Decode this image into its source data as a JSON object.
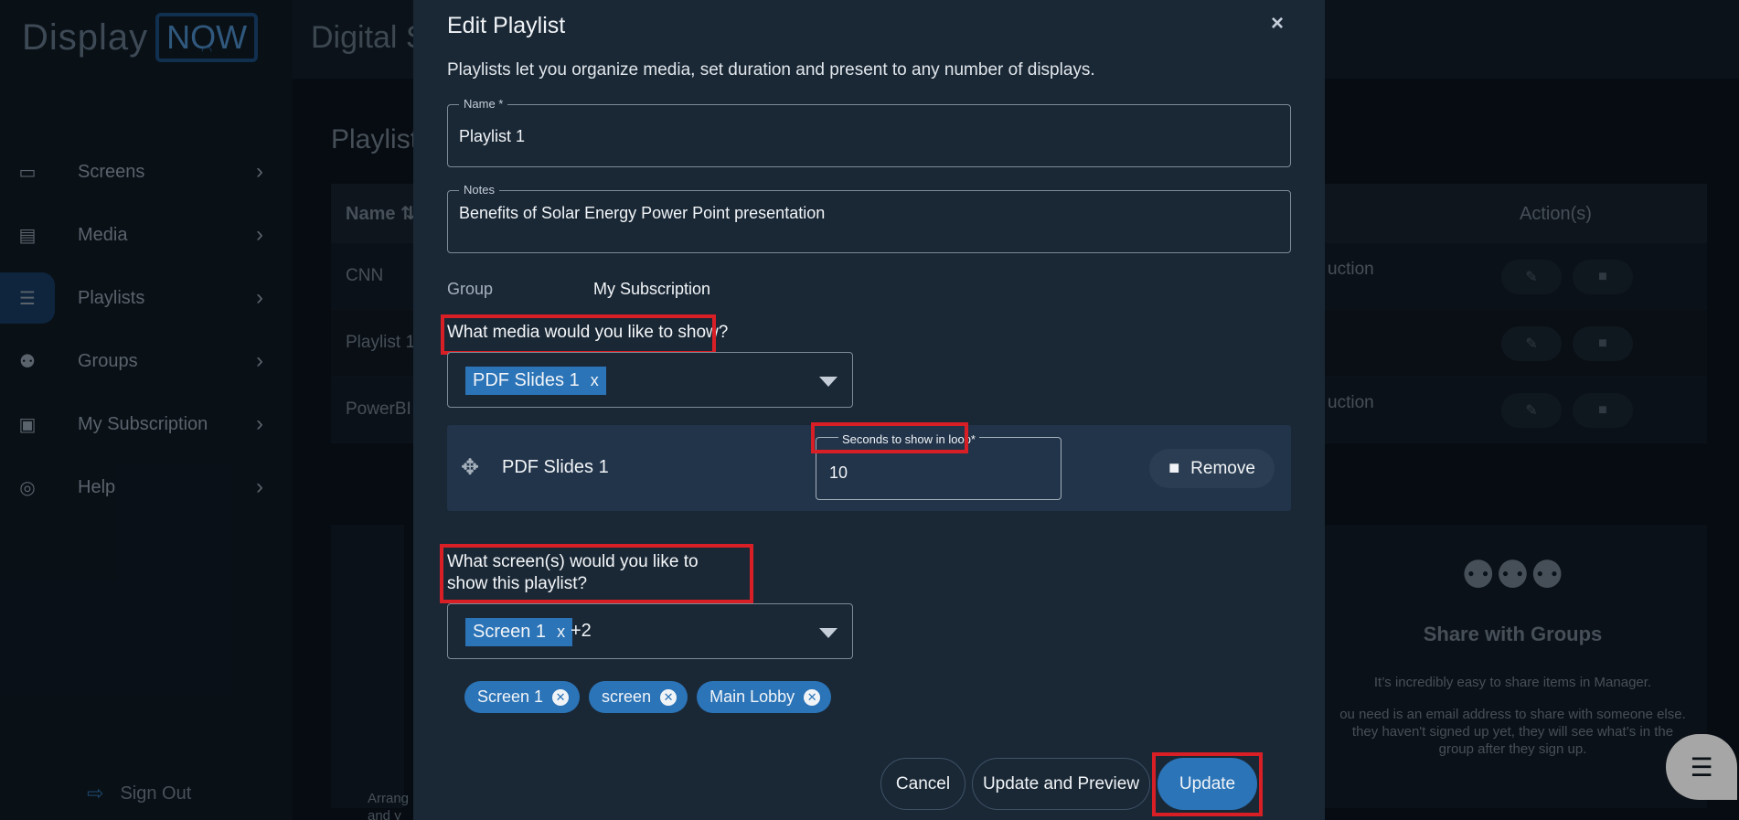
{
  "app": {
    "logo_display": "Display",
    "logo_now": "NOW",
    "topbar_title": "Digital S"
  },
  "sidebar": {
    "items": [
      {
        "label": "Screens",
        "icon": "monitor-icon"
      },
      {
        "label": "Media",
        "icon": "media-icon"
      },
      {
        "label": "Playlists",
        "icon": "list-icon"
      },
      {
        "label": "Groups",
        "icon": "users-icon"
      },
      {
        "label": "My Subscription",
        "icon": "lock-icon"
      },
      {
        "label": "Help",
        "icon": "lifebuoy-icon"
      }
    ],
    "signout": "Sign Out"
  },
  "main": {
    "section_title": "Playlist",
    "table_header_name": "Name",
    "table_header_actions": "Action(s)",
    "rows": [
      {
        "name": "CNN",
        "desc": "uction"
      },
      {
        "name": "Playlist 1",
        "desc": ""
      },
      {
        "name": "PowerBI",
        "desc": "uction"
      }
    ],
    "share_card": {
      "title": "Share with Groups",
      "line1": "It’s incredibly easy to share items in Manager.",
      "line2": "ou need is an email address to share with someone else. they haven't signed up yet, they will see what’s in the group after they sign up."
    },
    "left_card_text": "Arrang and y"
  },
  "modal": {
    "title": "Edit Playlist",
    "close": "×",
    "description": "Playlists let you organize media, set duration and present to any number of displays.",
    "name_label": "Name *",
    "name_value": "Playlist 1",
    "notes_label": "Notes",
    "notes_value": "Benefits of Solar Energy Power Point presentation",
    "group_label": "Group",
    "group_value": "My Subscription",
    "media_question": "What media would you like to show?",
    "media_tag": "PDF Slides 1",
    "media_tag_x": "x",
    "media_item": {
      "name": "PDF Slides 1",
      "seconds_label": "Seconds to show in loop*",
      "seconds_value": "10",
      "remove_label": "Remove"
    },
    "screens_question": "What screen(s) would you like to show this playlist?",
    "screens_tag": "Screen 1",
    "screens_tag_x": "x",
    "screens_more": "+2",
    "screen_chips": [
      "Screen 1",
      "screen",
      "Main Lobby"
    ],
    "cancel_label": "Cancel",
    "update_preview_label": "Update and Preview",
    "update_label": "Update"
  },
  "colors": {
    "accent": "#2b74b8",
    "highlight": "#d91f26",
    "modal_bg": "#1a2836"
  }
}
